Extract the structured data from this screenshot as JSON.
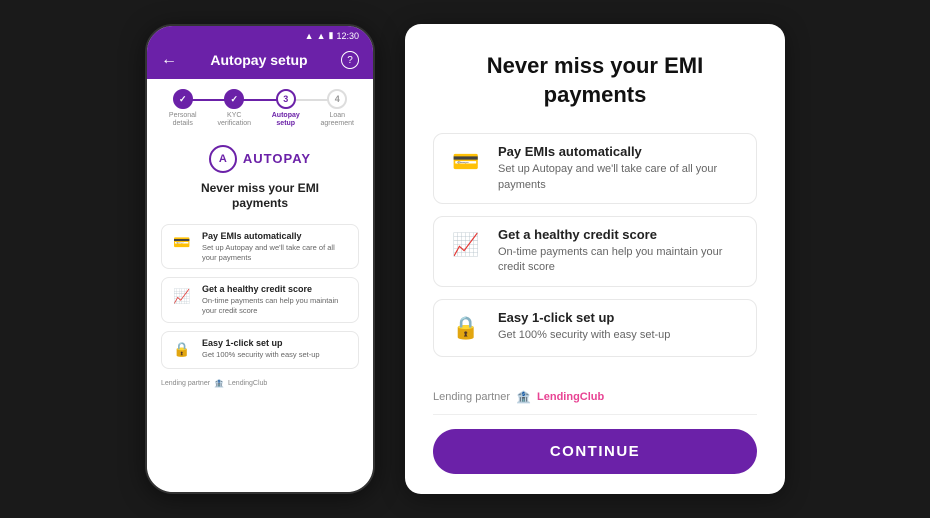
{
  "phone": {
    "status_bar": {
      "time": "12:30"
    },
    "header": {
      "title": "Autopay setup",
      "back_label": "←",
      "help_label": "?"
    },
    "stepper": {
      "steps": [
        {
          "label": "Personal\ndetails",
          "state": "completed",
          "number": "✓"
        },
        {
          "label": "KYC\nverification",
          "state": "completed",
          "number": "✓"
        },
        {
          "label": "Autopay\nsetup",
          "state": "active",
          "number": "3"
        },
        {
          "label": "Loan\nagreement",
          "state": "inactive",
          "number": "4"
        }
      ]
    },
    "autopay_logo": {
      "circle_letter": "A",
      "brand_name": "AUTOPAY"
    },
    "main_title": "Never miss your EMI\npayments",
    "features": [
      {
        "icon": "💳",
        "title": "Pay EMIs automatically",
        "description": "Set up Autopay and we'll take care of all your payments"
      },
      {
        "icon": "📈",
        "title": "Get a healthy credit score",
        "description": "On-time payments can help you maintain your credit score"
      },
      {
        "icon": "🔒",
        "title": "Easy 1-click set up",
        "description": "Get 100% security with easy set-up"
      }
    ],
    "lending_partner_label": "Lending partner",
    "lending_partner_name": "LendingClub"
  },
  "right_panel": {
    "title": "Never miss your EMI\npayments",
    "features": [
      {
        "icon": "💳",
        "title": "Pay EMIs automatically",
        "description": "Set up Autopay and we'll take care of all your payments"
      },
      {
        "icon": "📈",
        "title": "Get a healthy credit score",
        "description": "On-time payments can help you maintain your credit score"
      },
      {
        "icon": "🔒",
        "title": "Easy 1-click set up",
        "description": "Get 100% security with easy set-up"
      }
    ],
    "lending_partner_label": "Lending partner",
    "lending_partner_name": "LendingClub",
    "continue_button_label": "CONTINUE"
  }
}
